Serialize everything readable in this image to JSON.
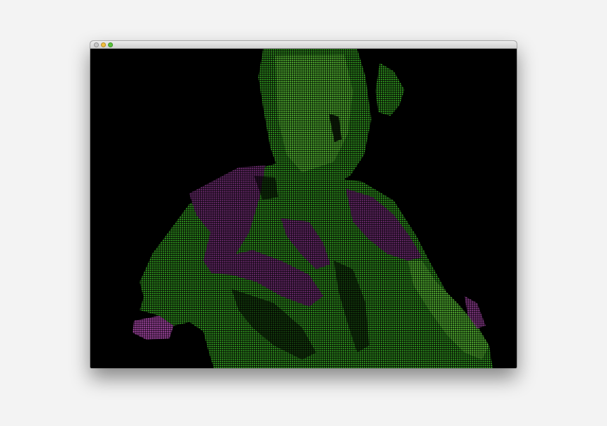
{
  "window": {
    "title": "",
    "controls": [
      {
        "name": "close",
        "color": "#c9c9c9"
      },
      {
        "name": "minimize",
        "color": "#f2bf3c"
      },
      {
        "name": "maximize",
        "color": "#58c43a"
      }
    ]
  },
  "canvas": {
    "content": "point-cloud",
    "background_color": "#000000",
    "colors": {
      "foreground_point": "#3fcf2a",
      "foreground_point_light": "#7ee04a",
      "background_point": "#6a2a6e",
      "background_point_light": "#b04fb0"
    }
  }
}
